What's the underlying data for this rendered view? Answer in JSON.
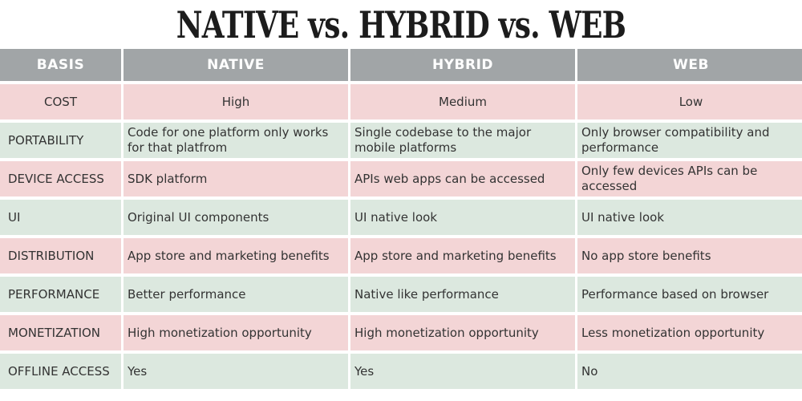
{
  "title": "NATIVE vs. HYBRID vs. WEB",
  "colors": {
    "header_bg": "#a1a5a7",
    "row_pink": "#f3d5d6",
    "row_green": "#dce8df",
    "text": "#333333"
  },
  "headers": [
    "BASIS",
    "NATIVE",
    "HYBRID",
    "WEB"
  ],
  "rows": [
    {
      "basis": "COST",
      "native": "High",
      "hybrid": "Medium",
      "web": "Low"
    },
    {
      "basis": "PORTABILITY",
      "native": "Code for one platform only works for that platfrom",
      "hybrid": "Single codebase to the major mobile platforms",
      "web": "Only browser compatibility and performance"
    },
    {
      "basis": "DEVICE ACCESS",
      "native": "SDK platform",
      "hybrid": "APIs web apps can be accessed",
      "web": "Only few devices APIs can be accessed"
    },
    {
      "basis": "UI",
      "native": "Original UI components",
      "hybrid": "UI native look",
      "web": "UI native look"
    },
    {
      "basis": "DISTRIBUTION",
      "native": "App store and marketing benefits",
      "hybrid": "App store and marketing benefits",
      "web": "No app store benefits"
    },
    {
      "basis": "PERFORMANCE",
      "native": "Better performance",
      "hybrid": "Native like performance",
      "web": "Performance based on browser"
    },
    {
      "basis": "MONETIZATION",
      "native": "High monetization opportunity",
      "hybrid": "High monetization opportunity",
      "web": "Less monetization opportunity"
    },
    {
      "basis": "OFFLINE ACCESS",
      "native": "Yes",
      "hybrid": "Yes",
      "web": "No"
    }
  ]
}
